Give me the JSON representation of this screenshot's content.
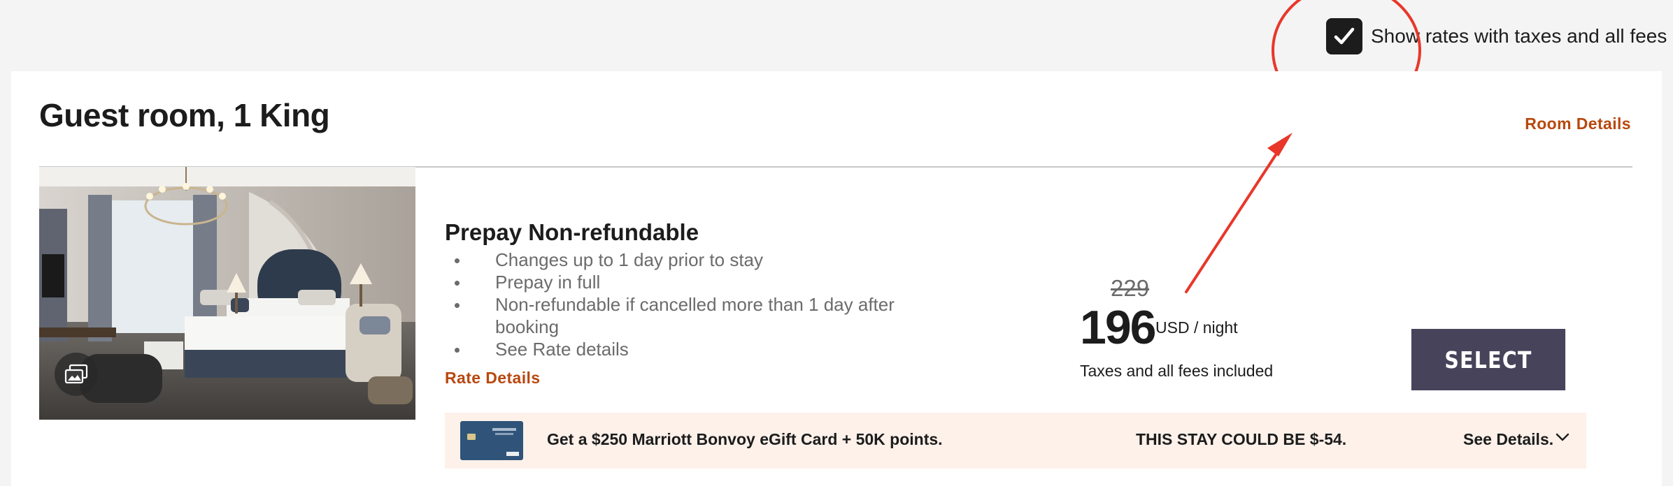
{
  "tax_toggle": {
    "label": "Show rates with taxes and all fees",
    "checked": true
  },
  "room": {
    "title": "Guest room, 1 King",
    "details_link": "Room Details",
    "photo_icon": "hotel-room-photo",
    "gallery_icon": "photo-gallery-icon"
  },
  "rate": {
    "name": "Prepay Non-refundable",
    "features": [
      "Changes up to 1 day prior to stay",
      "Prepay in full",
      "Non-refundable if cancelled more than 1 day after booking",
      "See Rate details"
    ],
    "details_link": "Rate Details"
  },
  "price": {
    "original": "229",
    "current": "196",
    "unit": "USD / night",
    "note": "Taxes and all fees included"
  },
  "select_button": "SELECT",
  "promo": {
    "card_icon": "marriott-bonvoy-credit-card",
    "text": "Get a $250 Marriott Bonvoy eGift Card + 50K points.",
    "savings": "THIS STAY COULD BE $-54.",
    "details_link": "See Details.",
    "details_icon": "chevron-down-icon"
  },
  "colors": {
    "accent": "#b8480f",
    "button": "#46435a",
    "promo_background": "#fdf1ea",
    "annotation": "#e8372a"
  }
}
